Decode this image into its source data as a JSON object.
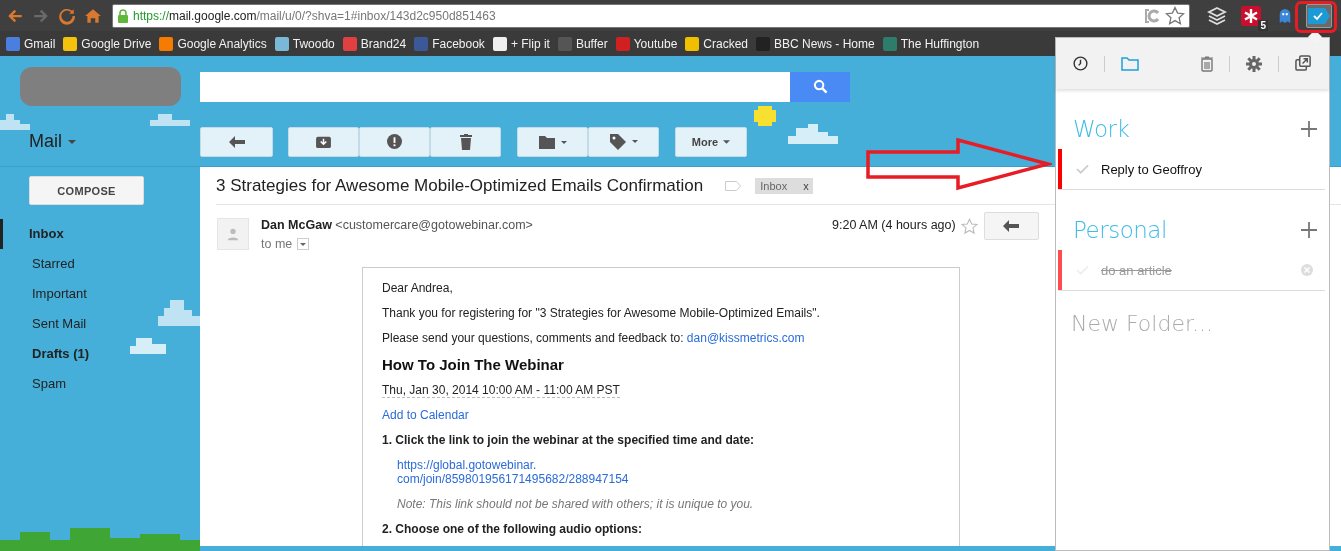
{
  "browser": {
    "address": {
      "scheme": "https://",
      "host": "mail.google.com",
      "path": "/mail/u/0/?shva=1#inbox/143d2c950d851463"
    },
    "bookmarks": [
      {
        "label": "Gmail",
        "color": "#4a7fe0"
      },
      {
        "label": "Google Drive",
        "color": "#f4c20d"
      },
      {
        "label": "Google Analytics",
        "color": "#f57c00"
      },
      {
        "label": "Twoodo",
        "color": "#7ab8d8"
      },
      {
        "label": "Brand24",
        "color": "#e04040"
      },
      {
        "label": "Facebook",
        "color": "#3b5998"
      },
      {
        "label": "+ Flip it",
        "color": "#f0f0f0"
      },
      {
        "label": "Buffer",
        "color": "#555555"
      },
      {
        "label": "Youtube",
        "color": "#d02020"
      },
      {
        "label": "Cracked",
        "color": "#f0c000"
      },
      {
        "label": "BBC News - Home",
        "color": "#222222"
      },
      {
        "label": "The Huffington",
        "color": "#2e7d6a"
      }
    ],
    "extensions": [
      {
        "kind": "stack",
        "selected": false
      },
      {
        "kind": "asterisk",
        "badge": "5",
        "selected": false
      },
      {
        "kind": "ghost",
        "selected": false
      },
      {
        "kind": "check",
        "selected": true
      }
    ]
  },
  "gmail": {
    "app_switcher": "Mail",
    "more_button": "More",
    "compose": "COMPOSE",
    "nav": [
      {
        "label": "Inbox",
        "bold": true,
        "selected": true
      },
      {
        "label": "Starred",
        "bold": false,
        "selected": false
      },
      {
        "label": "Important",
        "bold": false,
        "selected": false
      },
      {
        "label": "Sent Mail",
        "bold": false,
        "selected": false
      },
      {
        "label": "Drafts (1)",
        "bold": true,
        "selected": false
      },
      {
        "label": "Spam",
        "bold": false,
        "selected": false
      }
    ],
    "message": {
      "subject": "3 Strategies for Awesome Mobile-Optimized Emails Confirmation",
      "label": "Inbox",
      "label_remove": "x",
      "sender": "Dan McGaw",
      "sender_email": "<customercare@gotowebinar.com>",
      "recipient": "to me",
      "time": "9:20 AM (4 hours ago)",
      "body": [
        {
          "kind": "text",
          "text": "Dear Andrea,"
        },
        {
          "kind": "text",
          "text": "Thank you for registering for \"3 Strategies for Awesome Mobile-Optimized Emails\"."
        },
        {
          "kind": "contact",
          "text": "Please send your questions, comments and feedback to:",
          "link": "dan@kissmetrics.com"
        },
        {
          "kind": "heading",
          "text": "How To Join The Webinar"
        },
        {
          "kind": "date",
          "text": "Thu, Jan 30, 2014 10:00 AM - 11:00 AM PST"
        },
        {
          "kind": "link",
          "text": "Add to Calendar"
        },
        {
          "kind": "step",
          "text": "1. Click the link to join the webinar at the specified time and date:"
        },
        {
          "kind": "url",
          "text": "https://global.gotowebinar.\ncom/join/859801956171495682/288947154"
        },
        {
          "kind": "note",
          "text": "Note: This link should not be shared with others; it is unique to you."
        },
        {
          "kind": "step",
          "text": "2. Choose one of the following audio options:"
        }
      ]
    }
  },
  "popup": {
    "tabs": [
      {
        "kind": "history",
        "selected": false
      },
      {
        "kind": "folders",
        "selected": true
      },
      {
        "kind": "trash",
        "selected": false
      },
      {
        "kind": "settings",
        "selected": false
      },
      {
        "kind": "popout",
        "selected": false
      }
    ],
    "folders": [
      {
        "name": "Work",
        "tasks": [
          {
            "text": "Reply to Geoffroy",
            "done": false,
            "color": "#ff0000"
          }
        ]
      },
      {
        "name": "Personal",
        "tasks": [
          {
            "text": "do an article",
            "done": true,
            "color": "#ff4d4d"
          }
        ]
      }
    ],
    "new_folder_placeholder": "New Folder..."
  },
  "annotations": {
    "arrow": true,
    "highlight_box": true
  }
}
